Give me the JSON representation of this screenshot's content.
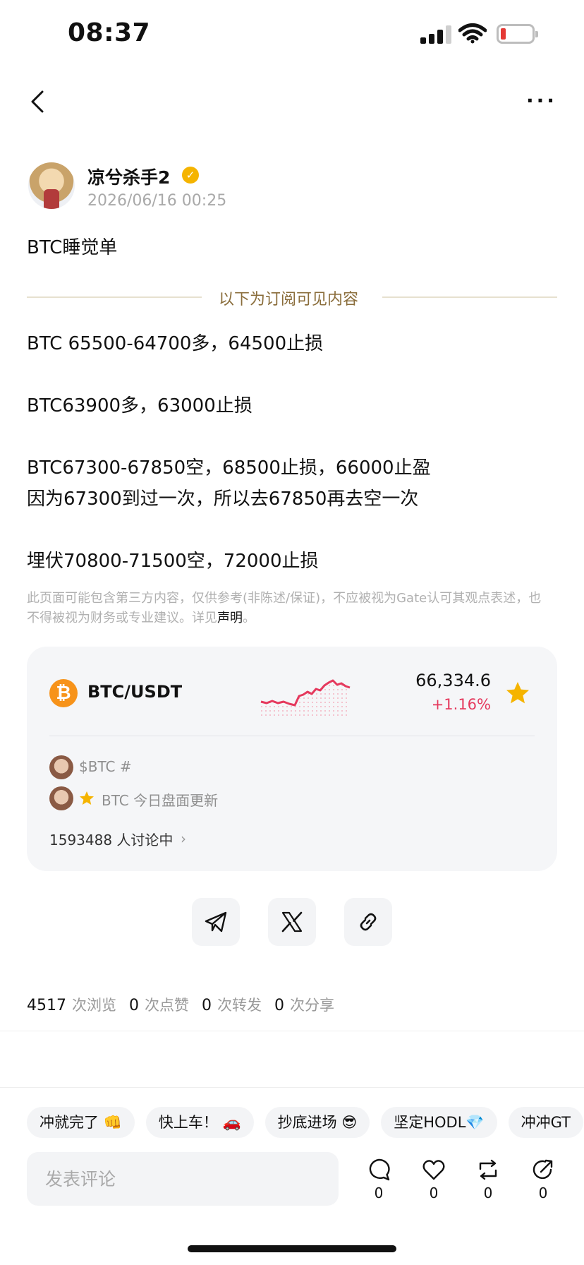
{
  "status_bar": {
    "time": "08:37"
  },
  "author": {
    "name": "凉兮杀手2",
    "date": "2026/06/16 00:25"
  },
  "post": {
    "title": "BTC睡觉单",
    "divider_text": "以下为订阅可见内容",
    "lines": [
      "BTC 65500-64700多，64500止损",
      "BTC63900多，63000止损",
      "BTC67300-67850空，68500止损，66000止盈",
      "因为67300到过一次，所以去67850再去空一次",
      "埋伏70800-71500空，72000止损"
    ],
    "disclaimer": "此页面可能包含第三方内容，仅供参考(非陈述/保证)，不应被视为Gate认可其观点表述，也不得被视为财务或专业建议。详见",
    "disclaimer_link": "声明",
    "disclaimer_end": "。"
  },
  "market_card": {
    "coin_symbol": "₿",
    "pair": "BTC/USDT",
    "price": "66,334.6",
    "change": "+1.16%",
    "accent_color": "#e5395d",
    "topic_1": "$BTC #",
    "topic_2": "BTC 今日盘面更新",
    "discussing": "1593488 人讨论中"
  },
  "share": {
    "icons": [
      "telegram-icon",
      "x-icon",
      "link-icon"
    ]
  },
  "stats": {
    "views": "4517",
    "views_label": "次浏览",
    "likes": "0",
    "likes_label": "次点赞",
    "reposts": "0",
    "reposts_label": "次转发",
    "shares": "0",
    "shares_label": "次分享"
  },
  "quick_replies": [
    "冲就完了 👊",
    "快上车！ 🚗",
    "抄底进场 😎",
    "坚定HODL💎",
    "冲冲GT"
  ],
  "comment_bar": {
    "placeholder": "发表评论",
    "comment_count": "0",
    "like_count": "0",
    "repost_count": "0",
    "share_count": "0"
  }
}
